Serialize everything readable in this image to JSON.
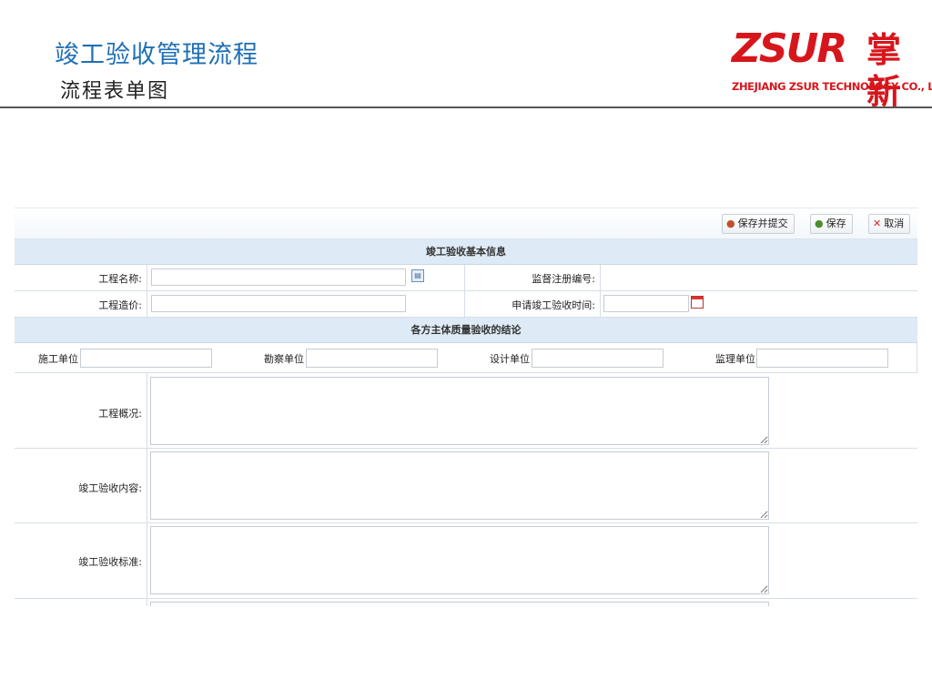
{
  "slide": {
    "title": "竣工验收管理流程",
    "subtitle": "流程表单图"
  },
  "logo": {
    "mark": "ZSUR",
    "cn": "掌新",
    "sub": "ZHEJIANG ZSUR TECHNOLOGY CO., LTD"
  },
  "toolbar": {
    "save_submit_label": "保存并提交",
    "save_label": "保存",
    "cancel_label": "取消"
  },
  "sections": {
    "basic_info": "竣工验收基本信息",
    "conclusion": "各方主体质量验收的结论"
  },
  "fields": {
    "project_name_label": "工程名称:",
    "project_name_value": "",
    "supervision_no_label": "监督注册编号:",
    "supervision_no_value": "",
    "project_cost_label": "工程造价:",
    "project_cost_value": "",
    "apply_time_label": "申请竣工验收时间:",
    "apply_time_value": ""
  },
  "units": {
    "construction_label": "施工单位",
    "survey_label": "勘察单位",
    "design_label": "设计单位",
    "supervisor_label": "监理单位"
  },
  "textareas": {
    "overview_label": "工程概况:",
    "content_label": "竣工验收内容:",
    "standard_label": "竣工验收标准:"
  },
  "colors": {
    "title_blue": "#1e6fb5",
    "brand_red": "#d7161c",
    "section_bg": "#deeaf5"
  },
  "icons": [
    "user-icon",
    "user-icon",
    "close-icon",
    "lookup-icon",
    "calendar-icon"
  ]
}
